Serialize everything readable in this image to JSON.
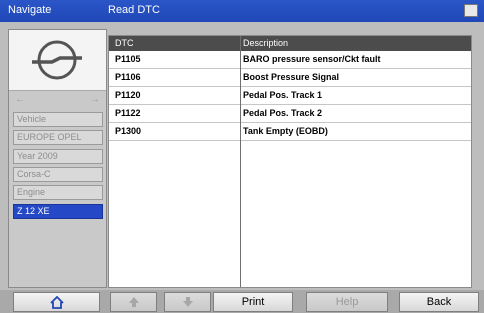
{
  "titlebar": {
    "left_title": "Navigate",
    "main_title": "Read DTC"
  },
  "sidebar": {
    "logo": "opel-logo-icon",
    "arrows": {
      "left": "←",
      "right": "→"
    },
    "vehicle_info": [
      {
        "label": "Vehicle",
        "selected": false
      },
      {
        "label": "EUROPE OPEL",
        "selected": false
      },
      {
        "label": "Year 2009",
        "selected": false
      },
      {
        "label": "Corsa-C",
        "selected": false
      },
      {
        "label": "Engine",
        "selected": false
      },
      {
        "label": "Z 12 XE",
        "selected": true
      }
    ]
  },
  "table": {
    "headers": {
      "dtc": "DTC",
      "description": "Description"
    },
    "rows": [
      {
        "dtc": "P1105",
        "description": "BARO pressure sensor/Ckt fault"
      },
      {
        "dtc": "P1106",
        "description": "Boost Pressure Signal"
      },
      {
        "dtc": "P1120",
        "description": "Pedal Pos. Track 1"
      },
      {
        "dtc": "P1122",
        "description": "Pedal Pos. Track 2"
      },
      {
        "dtc": "P1300",
        "description": "Tank Empty (EOBD)"
      }
    ]
  },
  "toolbar": {
    "home_icon": "home-icon",
    "up_icon": "arrow-up-icon",
    "down_icon": "arrow-down-icon",
    "print_label": "Print",
    "help_label": "Help",
    "back_label": "Back"
  },
  "colors": {
    "titlebar": "#2b56c8",
    "selection": "#2548c7",
    "table_header": "#4c4c4c"
  }
}
